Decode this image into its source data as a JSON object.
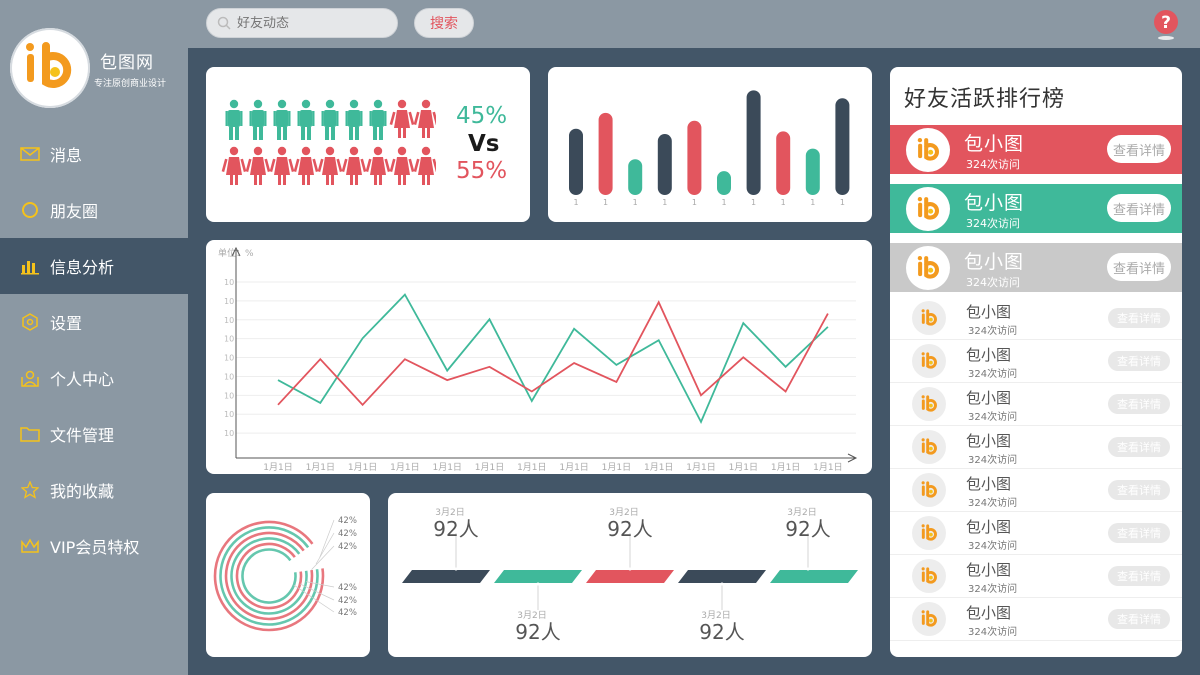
{
  "brand": {
    "name": "包图网",
    "subtitle": "专注原创商业设计",
    "logo_icon": "ib-logo-icon",
    "colors": {
      "orange": "#f39a1e",
      "yellow": "#f5c21b"
    }
  },
  "search": {
    "placeholder": "好友动态",
    "button_label": "搜索"
  },
  "help": {
    "label": "?"
  },
  "nav": [
    {
      "label": "消息",
      "icon": "mail-icon"
    },
    {
      "label": "朋友圈",
      "icon": "circle-icon"
    },
    {
      "label": "信息分析",
      "icon": "bar-chart-icon",
      "active": true
    },
    {
      "label": "设置",
      "icon": "hexagon-icon"
    },
    {
      "label": "个人中心",
      "icon": "user-icon"
    },
    {
      "label": "文件管理",
      "icon": "folder-icon"
    },
    {
      "label": "我的收藏",
      "icon": "star-icon"
    },
    {
      "label": "VIP会员特权",
      "icon": "crown-icon"
    }
  ],
  "gender": {
    "male_pct": "45%",
    "vs": "Vs",
    "female_pct": "55%",
    "male_icons": 7,
    "female_icons_row1": 2,
    "female_icons_row2": 9
  },
  "colors": {
    "green": "#3fb99a",
    "red": "#e2555e",
    "navy": "#3b4a59",
    "accent_gray": "#8b98a3"
  },
  "bar_chart": {
    "categories": [
      "1",
      "1",
      "1",
      "1",
      "1",
      "1",
      "1",
      "1",
      "1",
      "1"
    ],
    "values": [
      50,
      62,
      27,
      46,
      56,
      18,
      79,
      48,
      35,
      73
    ],
    "colors": [
      "navy",
      "red",
      "green",
      "navy",
      "red",
      "green",
      "navy",
      "red",
      "green",
      "navy"
    ]
  },
  "chart_data": [
    {
      "type": "line",
      "ylabel": "单位：%",
      "yticks": [
        "10",
        "10",
        "10",
        "10",
        "10",
        "10",
        "10",
        "10",
        "10"
      ],
      "x": [
        "1月1日",
        "1月1日",
        "1月1日",
        "1月1日",
        "1月1日",
        "1月1日",
        "1月1日",
        "1月1日",
        "1月1日",
        "1月1日",
        "1月1日",
        "1月1日",
        "1月1日",
        "1月1日"
      ],
      "ylim": [
        0,
        10
      ],
      "series": [
        {
          "color": "green",
          "values": [
            4.1,
            2.9,
            6.3,
            8.6,
            4.6,
            7.3,
            3.0,
            6.8,
            4.9,
            6.2,
            1.9,
            7.1,
            4.8,
            6.9
          ]
        },
        {
          "color": "red",
          "values": [
            2.8,
            5.2,
            2.8,
            5.2,
            4.1,
            4.8,
            3.5,
            5.0,
            4.0,
            8.2,
            3.3,
            5.3,
            3.5,
            7.6
          ]
        }
      ]
    },
    {
      "type": "pie",
      "rings": [
        {
          "label": "42%",
          "value": 42,
          "color": "red"
        },
        {
          "label": "42%",
          "value": 42,
          "color": "green"
        },
        {
          "label": "42%",
          "value": 42,
          "color": "red"
        },
        {
          "label": "42%",
          "value": 42,
          "color": "green"
        },
        {
          "label": "42%",
          "value": 42,
          "color": "red"
        },
        {
          "label": "42%",
          "value": 42,
          "color": "green"
        }
      ]
    }
  ],
  "timeline": [
    {
      "date": "3月2日",
      "count": "92人",
      "color": "navy",
      "label_pos": "top"
    },
    {
      "date": "3月2日",
      "count": "92人",
      "color": "green",
      "label_pos": "bottom"
    },
    {
      "date": "3月2日",
      "count": "92人",
      "color": "red",
      "label_pos": "top"
    },
    {
      "date": "3月2日",
      "count": "92人",
      "color": "navy",
      "label_pos": "bottom"
    },
    {
      "date": "3月2日",
      "count": "92人",
      "color": "green",
      "label_pos": "top"
    }
  ],
  "ranking": {
    "title": "好友活跃排行榜",
    "top": [
      {
        "name": "包小图",
        "visits": "324次访问",
        "button": "查看详情",
        "color": "#e2555e"
      },
      {
        "name": "包小图",
        "visits": "324次访问",
        "button": "查看详情",
        "color": "#3fb99a"
      },
      {
        "name": "包小图",
        "visits": "324次访问",
        "button": "查看详情",
        "color": "#c9c9c9"
      }
    ],
    "rest": [
      {
        "name": "包小图",
        "visits": "324次访问",
        "button": "查看详情"
      },
      {
        "name": "包小图",
        "visits": "324次访问",
        "button": "查看详情"
      },
      {
        "name": "包小图",
        "visits": "324次访问",
        "button": "查看详情"
      },
      {
        "name": "包小图",
        "visits": "324次访问",
        "button": "查看详情"
      },
      {
        "name": "包小图",
        "visits": "324次访问",
        "button": "查看详情"
      },
      {
        "name": "包小图",
        "visits": "324次访问",
        "button": "查看详情"
      },
      {
        "name": "包小图",
        "visits": "324次访问",
        "button": "查看详情"
      },
      {
        "name": "包小图",
        "visits": "324次访问",
        "button": "查看详情"
      }
    ]
  }
}
